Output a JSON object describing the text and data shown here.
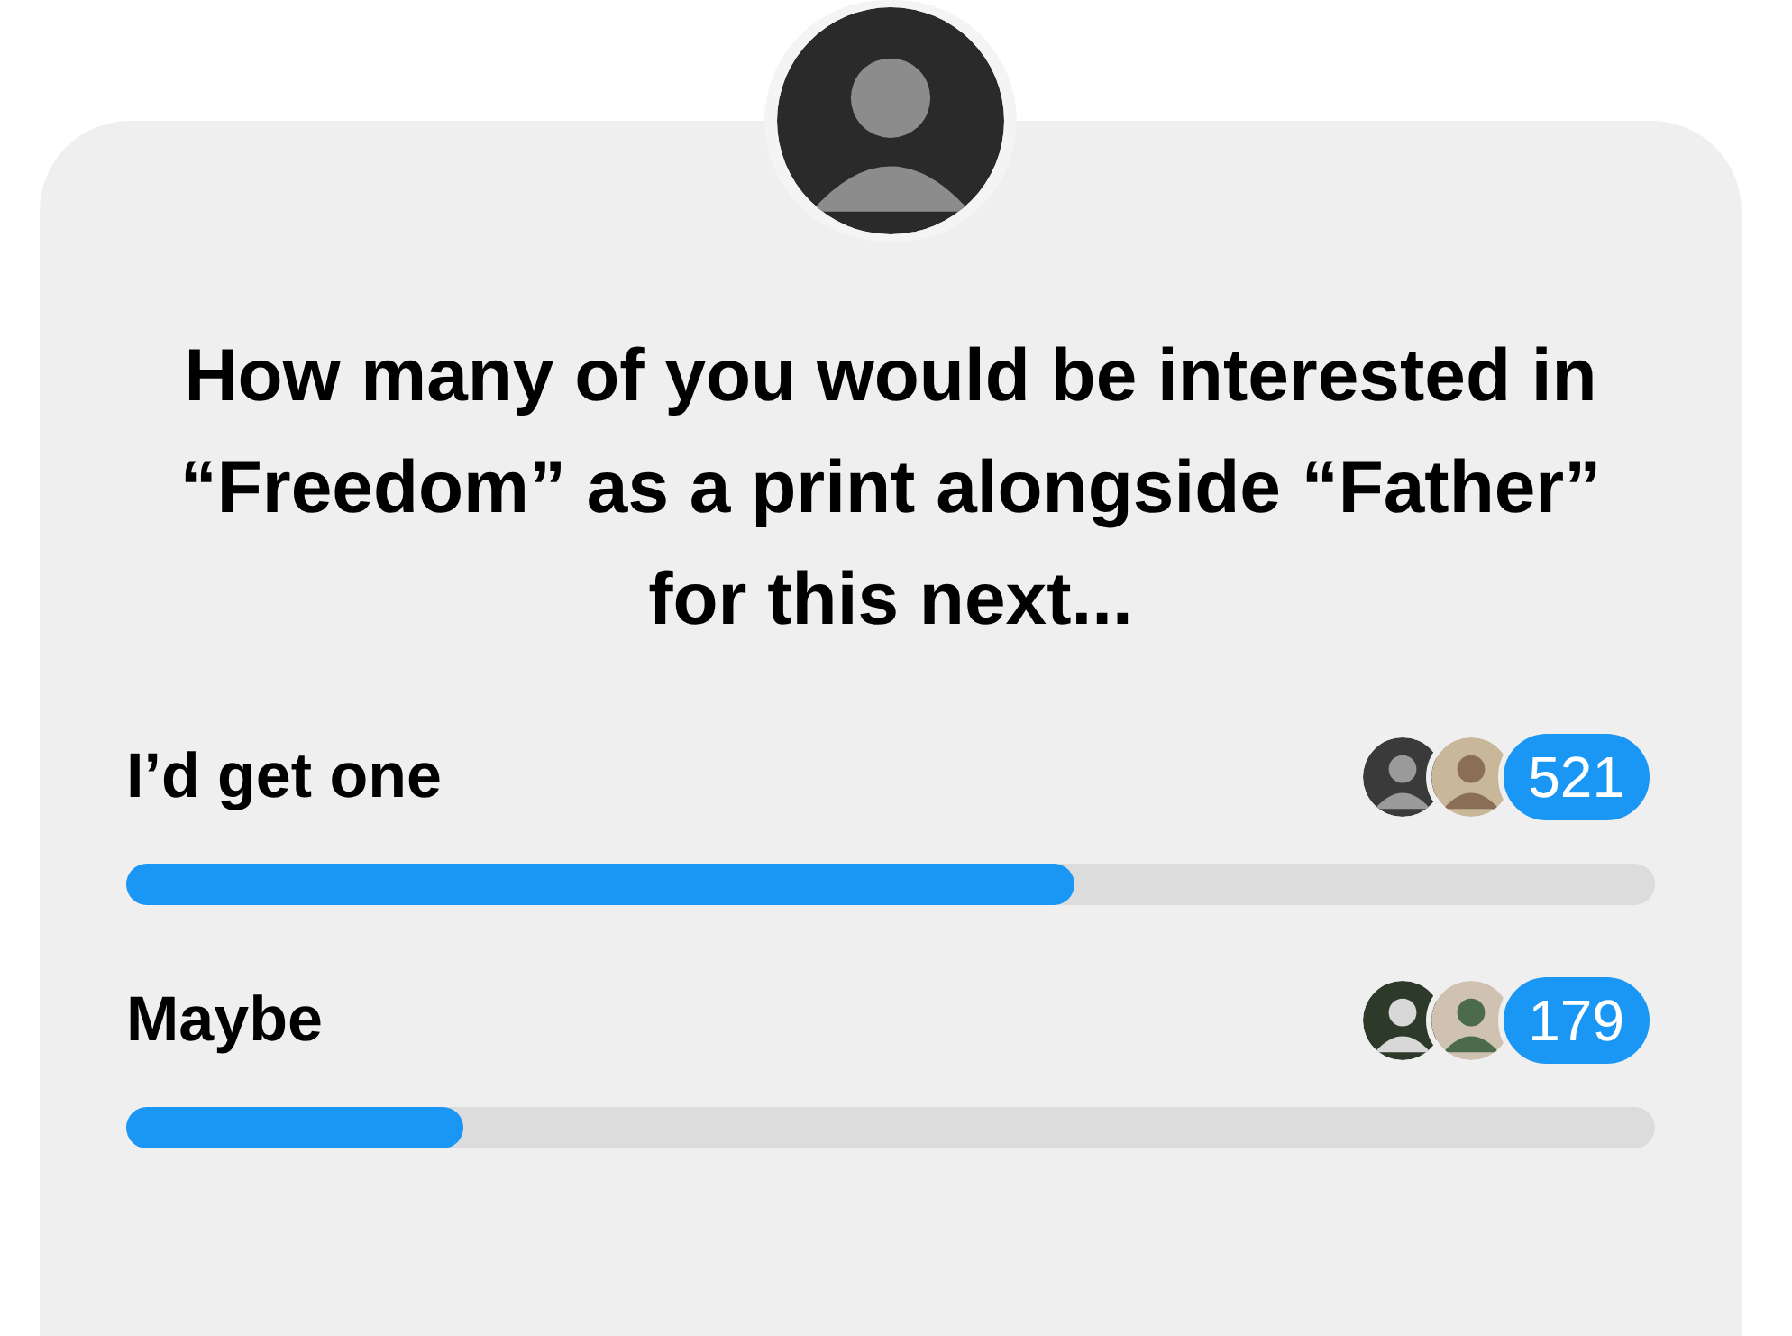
{
  "poll": {
    "question": "How many of you would be interested in “Freedom” as a print alongside “Father” for this next...",
    "options": [
      {
        "label": "I’d get one",
        "count": "521",
        "level": 0.62
      },
      {
        "label": "Maybe",
        "count": "179",
        "level": 0.22
      }
    ]
  }
}
